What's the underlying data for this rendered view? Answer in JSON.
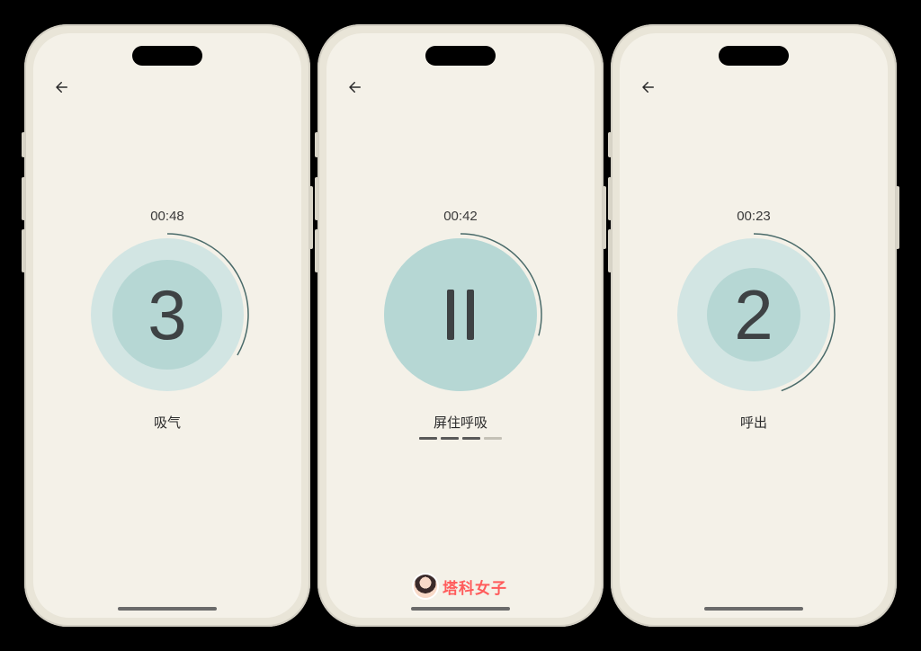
{
  "phones": [
    {
      "timer": "00:48",
      "count": "3",
      "phase": "吸气",
      "show_pause": false,
      "show_dashes": false,
      "outer_size": 170,
      "inner_size": 122,
      "arc_end_deg": 120
    },
    {
      "timer": "00:42",
      "count": "",
      "phase": "屏住呼吸",
      "show_pause": true,
      "show_dashes": true,
      "outer_size": 170,
      "inner_size": 170,
      "arc_end_deg": 105
    },
    {
      "timer": "00:23",
      "count": "2",
      "phase": "呼出",
      "show_pause": false,
      "show_dashes": false,
      "outer_size": 170,
      "inner_size": 104,
      "arc_end_deg": 160
    }
  ],
  "colors": {
    "arc": "#4a6b6a",
    "outer": "#d2e5e3",
    "inner": "#b6d7d4",
    "screen_bg": "#f4f1e8"
  },
  "watermark": "塔科女子"
}
